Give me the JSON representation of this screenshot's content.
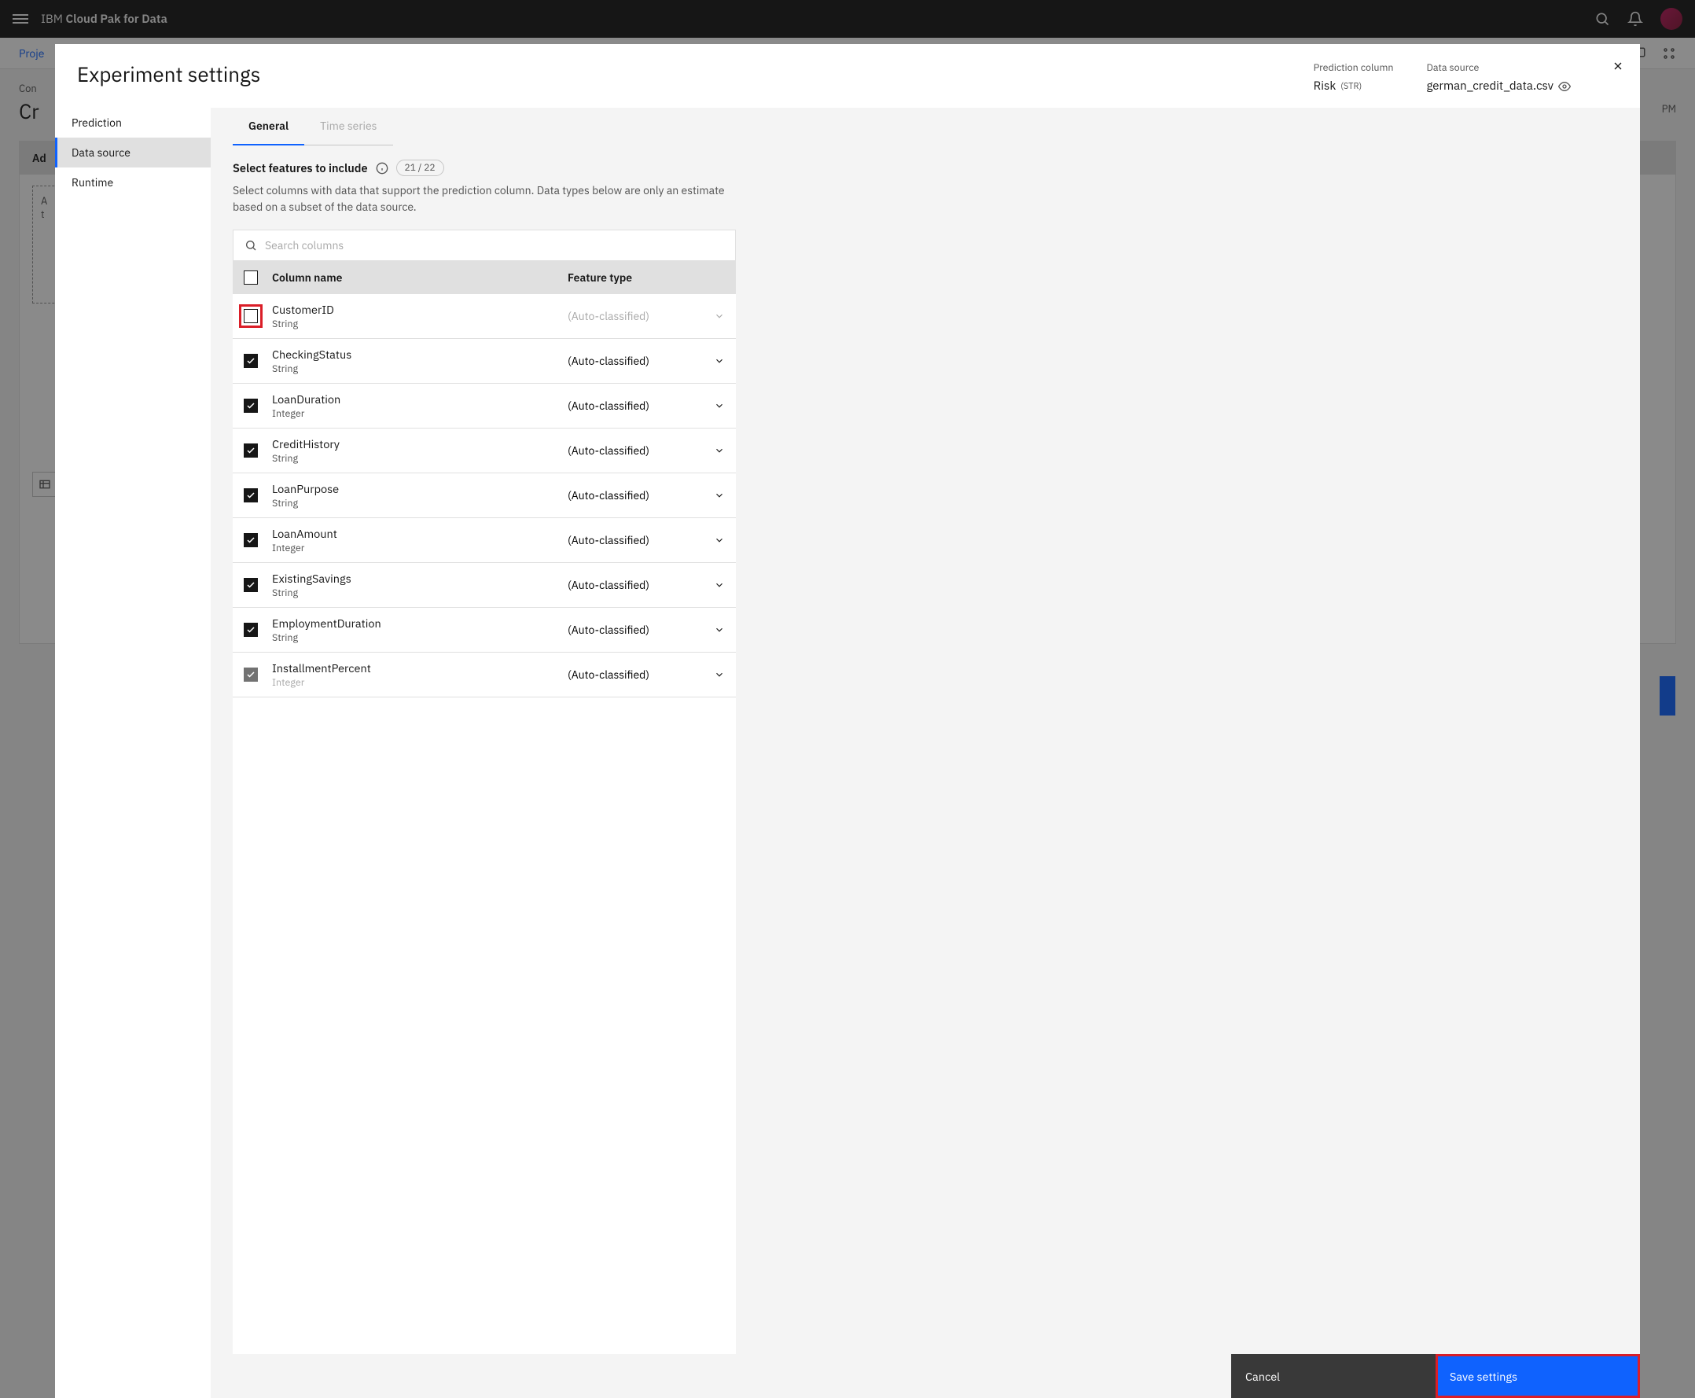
{
  "header": {
    "brand_prefix": "IBM",
    "brand_suffix": "Cloud Pak for Data"
  },
  "subnav": {
    "link": "Proje"
  },
  "page": {
    "breadcrumb": "Con",
    "title": "Cr",
    "panel_header": "Ad",
    "dashed_line1": "A",
    "dashed_line2": "t",
    "saved_suffix": "PM"
  },
  "modal": {
    "title": "Experiment settings",
    "meta": {
      "pred_label": "Prediction column",
      "pred_value": "Risk",
      "pred_tag": "(STR)",
      "ds_label": "Data source",
      "ds_value": "german_credit_data.csv"
    },
    "sidebar": {
      "items": [
        {
          "label": "Prediction",
          "active": false
        },
        {
          "label": "Data source",
          "active": true
        },
        {
          "label": "Runtime",
          "active": false
        }
      ]
    },
    "tabs": {
      "general": "General",
      "timeseries": "Time series"
    },
    "section": {
      "title": "Select features to include",
      "count": "21 / 22",
      "desc": "Select columns with data that support the prediction column. Data types below are only an estimate based on a subset of the data source."
    },
    "search_placeholder": "Search columns",
    "table": {
      "head_name": "Column name",
      "head_type": "Feature type",
      "auto": "(Auto-classified)",
      "rows": [
        {
          "name": "CustomerID",
          "dtype": "String",
          "checked": false,
          "highlight": true,
          "disabled": true
        },
        {
          "name": "CheckingStatus",
          "dtype": "String",
          "checked": true
        },
        {
          "name": "LoanDuration",
          "dtype": "Integer",
          "checked": true
        },
        {
          "name": "CreditHistory",
          "dtype": "String",
          "checked": true
        },
        {
          "name": "LoanPurpose",
          "dtype": "String",
          "checked": true
        },
        {
          "name": "LoanAmount",
          "dtype": "Integer",
          "checked": true
        },
        {
          "name": "ExistingSavings",
          "dtype": "String",
          "checked": true
        },
        {
          "name": "EmploymentDuration",
          "dtype": "String",
          "checked": true
        },
        {
          "name": "InstallmentPercent",
          "dtype": "Integer",
          "checked": true,
          "faded": true
        }
      ]
    },
    "footer": {
      "cancel": "Cancel",
      "save": "Save settings"
    }
  }
}
